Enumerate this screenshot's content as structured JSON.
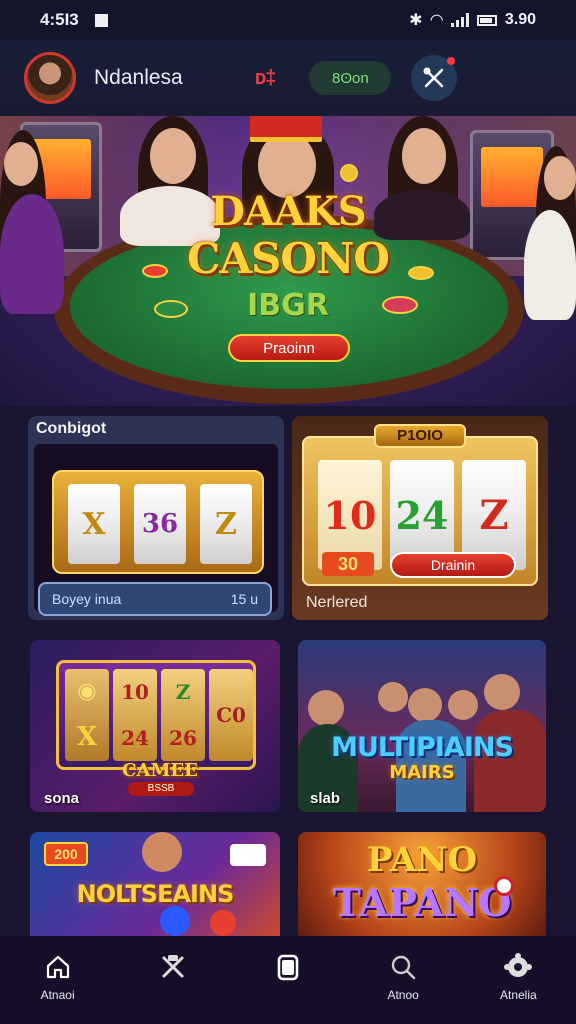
{
  "status_bar": {
    "time": "4:5I3",
    "battery": "3.90"
  },
  "header": {
    "username": "Ndanlesa",
    "flag_text": "ᴅ‡",
    "balance": "8ʘon"
  },
  "hero": {
    "title_line1": "DAAKS",
    "title_line2": "CASONO",
    "subtitle": "IBGR",
    "cta": "Praoinn"
  },
  "cards": [
    {
      "section_label": "Conbigot",
      "bar_left": "Boyey inua",
      "bar_right": "15 u",
      "reels": [
        "X",
        "36",
        "Z"
      ]
    },
    {
      "badge": "P1OIO",
      "cta": "Drainin",
      "footer": "Nerlered",
      "reels": [
        "10",
        "24",
        "Z"
      ],
      "sub": "30"
    },
    {
      "label": "sona",
      "reels": [
        "X",
        "24",
        "26"
      ],
      "reels2": [
        "10",
        "Z",
        "C0"
      ],
      "title": "CAMEE",
      "subtitle": "BSSB"
    },
    {
      "label": "slab",
      "title": "MULTIPIAINS",
      "subtitle": "MAIRS"
    },
    {
      "title": "NOLTSEAINS",
      "badge": "200"
    },
    {
      "title_line1": "PANO",
      "title_line2": "TAPANO"
    }
  ],
  "bottom_nav": [
    {
      "label": "Atnaoi",
      "icon": "home-icon"
    },
    {
      "label": "",
      "icon": "tools-icon"
    },
    {
      "label": "",
      "icon": "wallet-icon"
    },
    {
      "label": "Atnoo",
      "icon": "search-icon"
    },
    {
      "label": "Atnelia",
      "icon": "settings-icon"
    }
  ]
}
